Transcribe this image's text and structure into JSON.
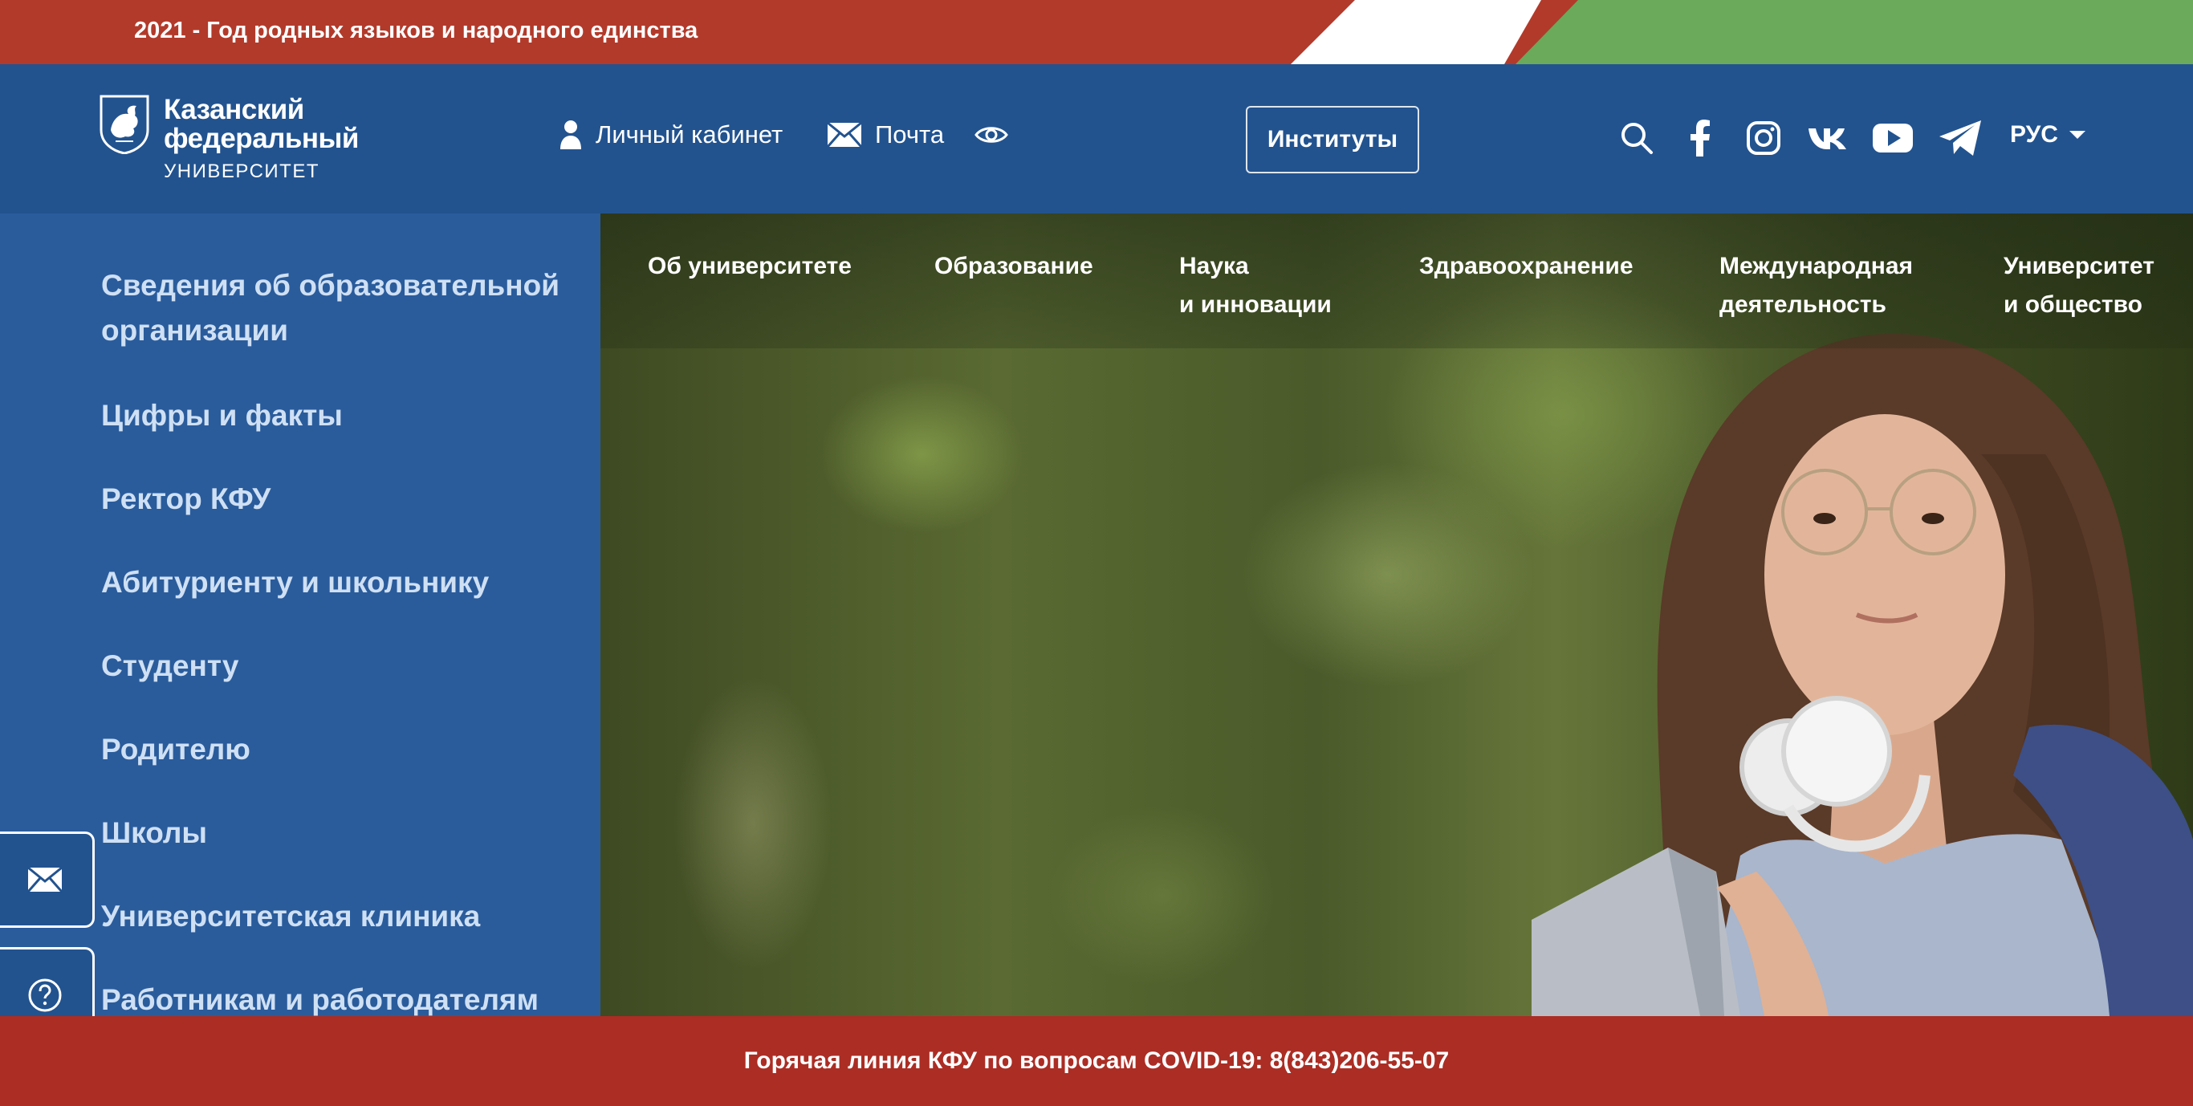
{
  "banner": {
    "title": "2021 - Год родных языков и народного единства",
    "flag_colors": {
      "red": "#b23a2b",
      "white": "#ffffff",
      "green": "#6aaa5a"
    }
  },
  "header": {
    "logo": {
      "line1": "Казанский",
      "line2": "федеральный",
      "line3": "УНИВЕРСИТЕТ"
    },
    "cabinet_label": "Личный кабинет",
    "mail_label": "Почта",
    "institutes_label": "Институты",
    "language": "РУС",
    "icons": [
      "search-icon",
      "facebook-icon",
      "instagram-icon",
      "vk-icon",
      "youtube-icon",
      "telegram-icon"
    ],
    "colors": {
      "header_bg": "#22538f",
      "sidebar_bg": "#2a5c9c",
      "footer_bg": "#ab2d24"
    }
  },
  "sidebar": {
    "items": [
      {
        "label": "Сведения об образовательной организации"
      },
      {
        "label": "Цифры и факты"
      },
      {
        "label": "Ректор КФУ"
      },
      {
        "label": "Абитуриенту и школьнику"
      },
      {
        "label": "Студенту"
      },
      {
        "label": "Родителю"
      },
      {
        "label": "Школы"
      },
      {
        "label": "Университетская клиника"
      },
      {
        "label": "Работникам и работодателям"
      }
    ]
  },
  "topnav": {
    "items": [
      {
        "line1": "Об университете",
        "line2": ""
      },
      {
        "line1": "Образование",
        "line2": ""
      },
      {
        "line1": "Наука",
        "line2": "и инновации"
      },
      {
        "line1": "Здравоохранение",
        "line2": ""
      },
      {
        "line1": "Международная",
        "line2": "деятельность"
      },
      {
        "line1": "Университет",
        "line2": "и общество"
      }
    ]
  },
  "footer": {
    "hotline": "Горячая линия КФУ по вопросам COVID-19: 8(843)206-55-07"
  }
}
